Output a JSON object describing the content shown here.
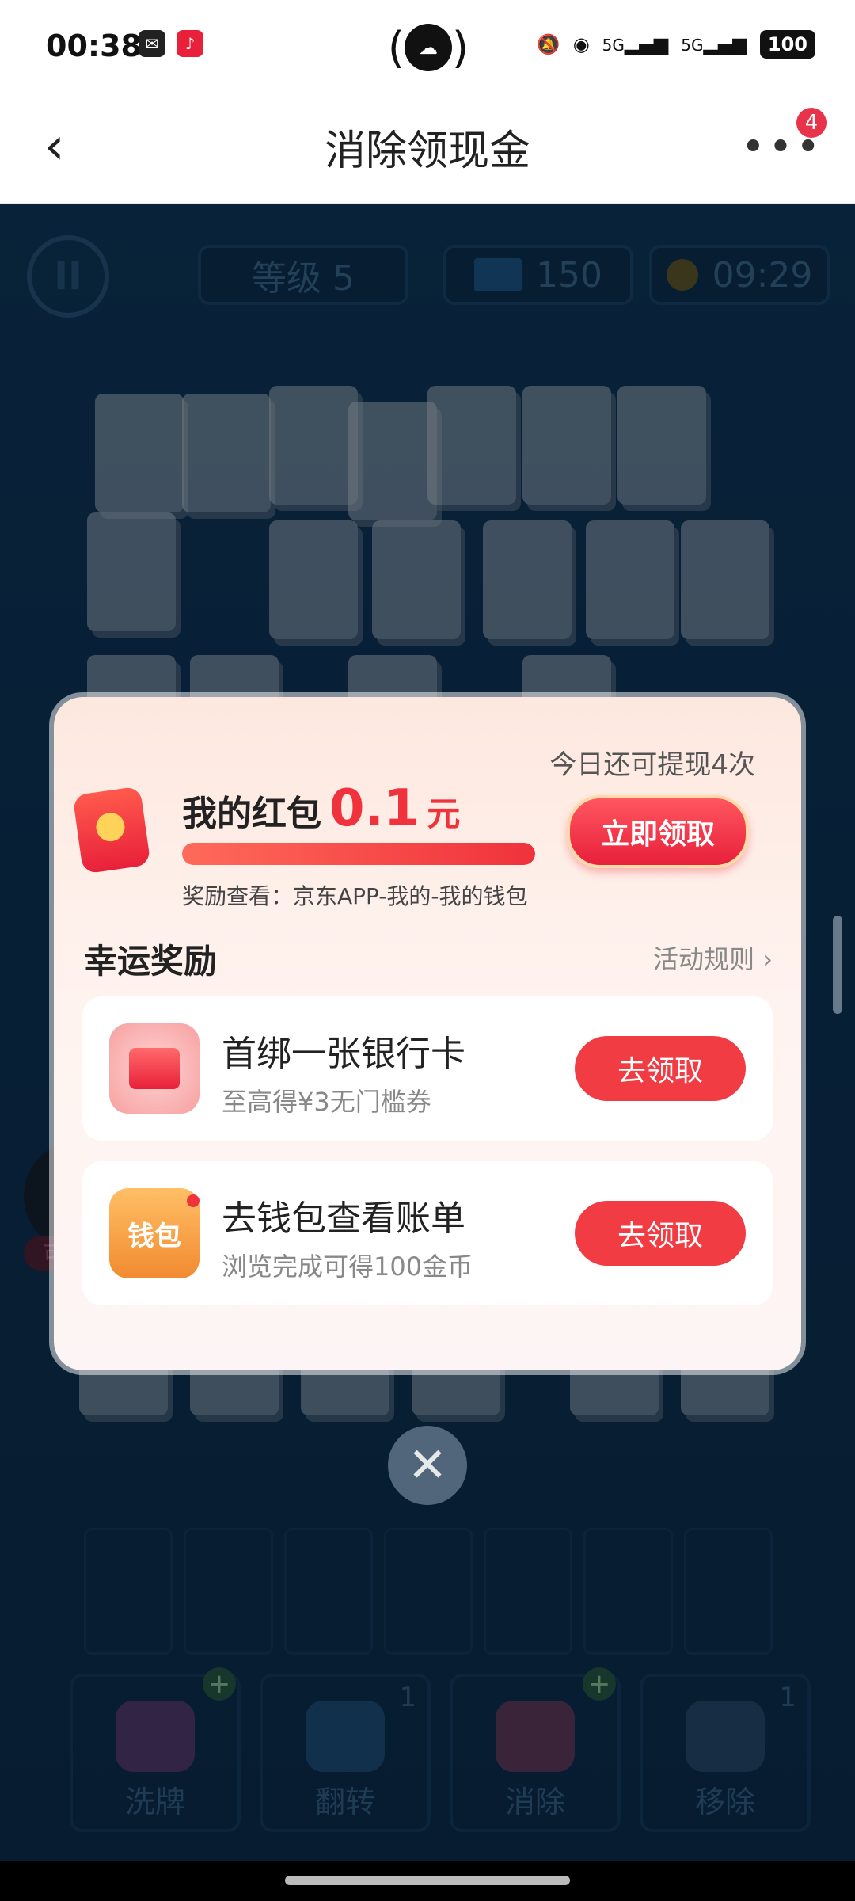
{
  "status_bar": {
    "time": "00:38",
    "left_icons": [
      "wechat-icon",
      "douyin-icon"
    ],
    "right_icons": [
      "mute-icon",
      "wifi-icon",
      "signal-5g-icon",
      "signal-5g-icon"
    ],
    "signal_label_1": "5G",
    "signal_label_2": "5G",
    "battery": "100"
  },
  "header": {
    "title": "消除领现金",
    "more_badge": "4"
  },
  "game": {
    "level": "等级 5",
    "tiles_count": "150",
    "timer": "09:29",
    "side_claim_label": "可领取",
    "tools": [
      {
        "label": "洗牌",
        "count": "+"
      },
      {
        "label": "翻转",
        "count": "1"
      },
      {
        "label": "消除",
        "count": "+"
      },
      {
        "label": "移除",
        "count": "1"
      }
    ]
  },
  "modal": {
    "withdraw_info": "今日还可提现4次",
    "red_packet_label": "我的红包",
    "red_packet_value": "0.1",
    "red_packet_unit": "元",
    "claim_now": "立即领取",
    "reward_hint": "奖励查看：京东APP-我的-我的钱包",
    "progress": 1.0,
    "lucky_title": "幸运奖励",
    "rules_link": "活动规则 ›",
    "tasks": [
      {
        "title": "首绑一张银行卡",
        "subtitle": "至高得¥3无门槛券",
        "button": "去领取"
      },
      {
        "title": "去钱包查看账单",
        "subtitle": "浏览完成可得100金币",
        "button": "去领取",
        "icon_label": "钱包"
      }
    ]
  },
  "colors": {
    "accent_red": "#f0323c",
    "game_bg": "#0f2d44"
  }
}
